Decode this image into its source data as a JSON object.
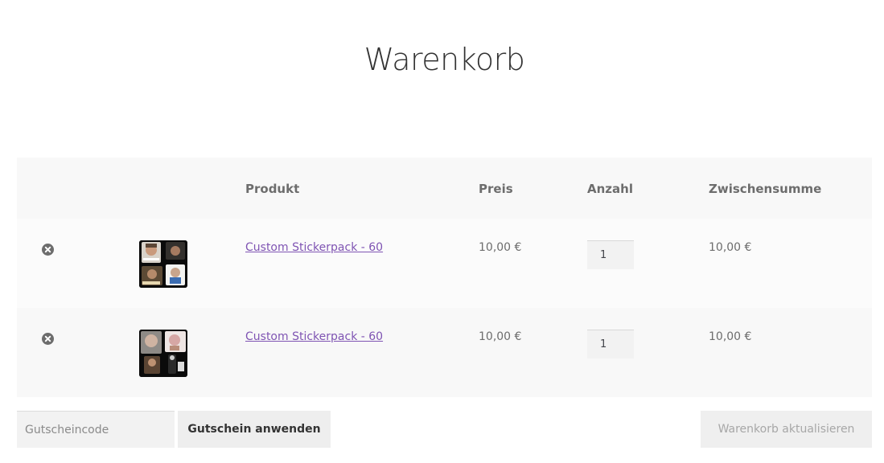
{
  "page": {
    "title": "Warenkorb"
  },
  "cart": {
    "columns": {
      "product": "Produkt",
      "price": "Preis",
      "quantity": "Anzahl",
      "subtotal": "Zwischensumme"
    },
    "items": [
      {
        "name": "Custom Stickerpack - 60",
        "price": "10,00 €",
        "quantity": "1",
        "subtotal": "10,00 €",
        "thumbnail_icon": "sticker-collage-image"
      },
      {
        "name": "Custom Stickerpack - 60",
        "price": "10,00 €",
        "quantity": "1",
        "subtotal": "10,00 €",
        "thumbnail_icon": "sticker-collage-image"
      }
    ]
  },
  "actions": {
    "coupon_placeholder": "Gutscheincode",
    "apply_coupon_label": "Gutschein anwenden",
    "update_cart_label": "Warenkorb aktualisieren"
  },
  "colors": {
    "link": "#7f54b3",
    "header_bg": "#f8f8f8",
    "text": "#6d6d6d",
    "remove_icon": "#6d6d6d"
  }
}
